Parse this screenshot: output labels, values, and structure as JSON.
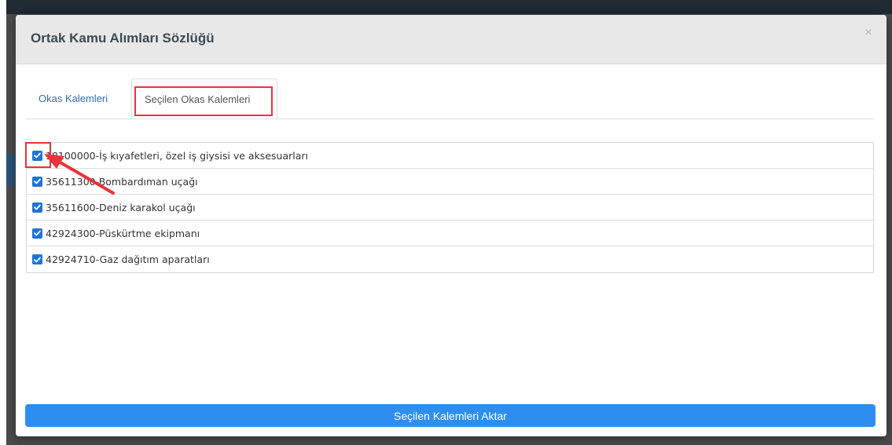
{
  "modal": {
    "title": "Ortak Kamu Alımları Sözlüğü",
    "close_symbol": "×"
  },
  "tabs": [
    {
      "label": "Okas Kalemleri",
      "active": false
    },
    {
      "label": "Seçilen Okas Kalemleri",
      "active": true
    }
  ],
  "items": [
    {
      "label": "18100000-İş kıyafetleri, özel iş giysisi ve aksesuarları",
      "checked": true
    },
    {
      "label": "35611300-Bombardıman uçağı",
      "checked": true
    },
    {
      "label": "35611600-Deniz karakol uçağı",
      "checked": true
    },
    {
      "label": "42924300-Püskürtme ekipmanı",
      "checked": true
    },
    {
      "label": "42924710-Gaz dağıtım aparatları",
      "checked": true
    }
  ],
  "submit_label": "Seçilen Kalemleri Aktar",
  "icons": {
    "checkbox": "check-icon",
    "close": "close-icon",
    "annotation": "arrow-icon"
  },
  "colors": {
    "accent": "#2d8ef0",
    "checkbox": "#1f73d8",
    "annotation": "#e8333b"
  }
}
